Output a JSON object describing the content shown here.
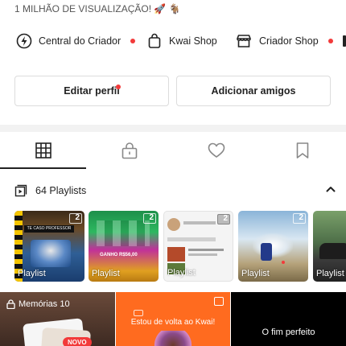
{
  "profile": {
    "milestone_text": "1 MILHÃO DE VISUALIZAÇÃO! 🚀 🐐"
  },
  "quick_links": [
    {
      "label": "Central do Criador",
      "icon": "lightning-icon",
      "has_dot": true
    },
    {
      "label": "Kwai Shop",
      "icon": "shopping-bag-icon",
      "has_dot": false
    },
    {
      "label": "Criador Shop",
      "icon": "storefront-icon",
      "has_dot": true
    }
  ],
  "actions": {
    "edit_profile": "Editar perfil",
    "add_friends": "Adicionar amigos"
  },
  "tabs": [
    {
      "name": "grid-icon",
      "active": true
    },
    {
      "name": "lock-icon",
      "active": false
    },
    {
      "name": "heart-icon",
      "active": false
    },
    {
      "name": "bookmark-icon",
      "active": false
    }
  ],
  "playlists": {
    "header": "64 Playlists",
    "items": [
      {
        "label": "Playlist",
        "count": "2",
        "caption": "TE CASO PROFESSOR"
      },
      {
        "label": "Playlist",
        "count": "2",
        "caption": "GANHO R$56,00"
      },
      {
        "label": "Playlist",
        "count": "2",
        "caption": ""
      },
      {
        "label": "Playlist",
        "count": "2",
        "caption": ""
      },
      {
        "label": "Playlist",
        "count": "",
        "caption": ""
      }
    ]
  },
  "feed": {
    "memories_label": "Memórias 10",
    "memories_badge": "NOVO",
    "promo_text": "Estou de volta ao Kwai!",
    "video_caption": "O fim perfeito"
  },
  "colors": {
    "accent_red": "#f23a3a",
    "promo_orange": "#ff6b1f"
  }
}
